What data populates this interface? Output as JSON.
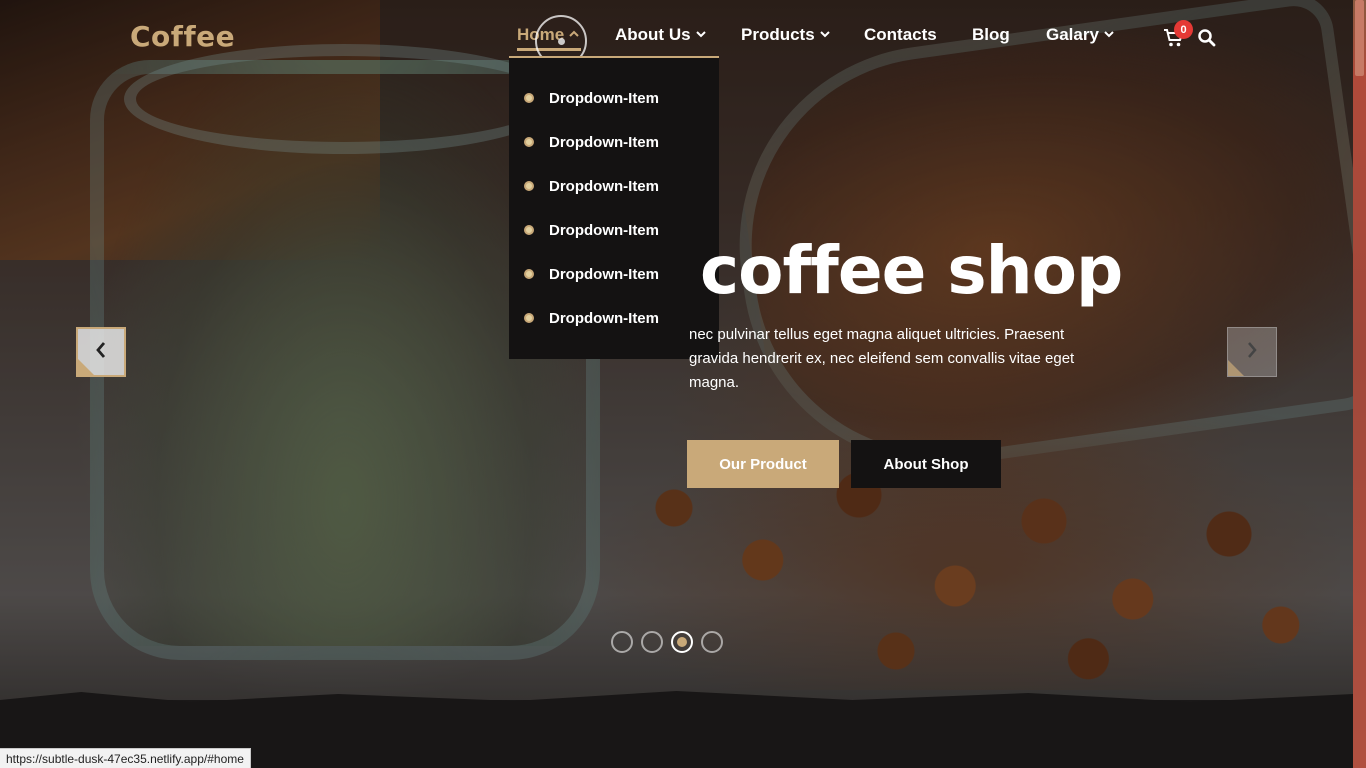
{
  "header": {
    "logo": "Coffee",
    "nav": [
      {
        "label": "Home",
        "has_dropdown": true,
        "active": true
      },
      {
        "label": "About Us",
        "has_dropdown": true
      },
      {
        "label": "Products",
        "has_dropdown": true
      },
      {
        "label": "Contacts",
        "has_dropdown": false
      },
      {
        "label": "Blog",
        "has_dropdown": false
      },
      {
        "label": "Galary",
        "has_dropdown": true
      }
    ],
    "cart_count": "0",
    "icons": {
      "cart": "cart-icon",
      "search": "search-icon"
    }
  },
  "dropdown": {
    "items": [
      "Dropdown-Item",
      "Dropdown-Item",
      "Dropdown-Item",
      "Dropdown-Item",
      "Dropdown-Item",
      "Dropdown-Item"
    ]
  },
  "hero": {
    "title": "coffee shop",
    "description": "nec pulvinar tellus eget magna aliquet ultricies. Praesent gravida hendrerit ex, nec eleifend sem convallis vitae eget magna.",
    "primary_button": "Our Product",
    "secondary_button": "About Shop",
    "slides": 4,
    "active_slide": 3
  },
  "status_bar": {
    "url": "https://subtle-dusk-47ec35.netlify.app/#home"
  },
  "colors": {
    "accent": "#c9a979",
    "dark": "#141212",
    "badge": "#e53935"
  }
}
